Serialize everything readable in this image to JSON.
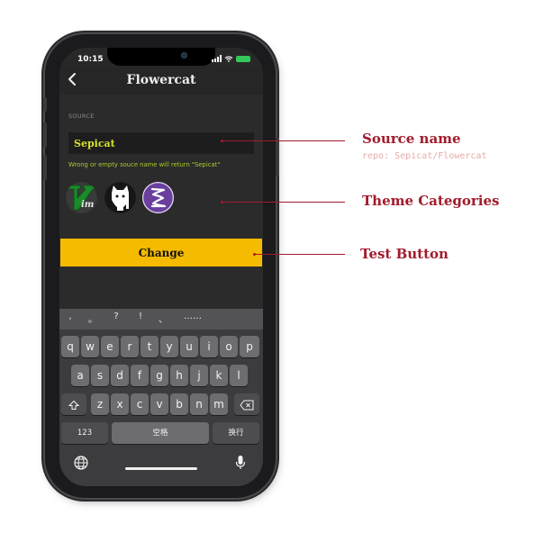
{
  "status_bar": {
    "time": "10:15",
    "battery": ""
  },
  "nav": {
    "title": "Flowercat"
  },
  "form": {
    "source_label": "SOURCE",
    "source_value": "Sepicat",
    "hint": "Wrong or empty souce name will return \"Sepicat\""
  },
  "themes": [
    {
      "name": "vim",
      "icon": "vim-icon"
    },
    {
      "name": "cat",
      "icon": "cat-icon"
    },
    {
      "name": "emacs",
      "icon": "emacs-icon"
    }
  ],
  "button": {
    "change_label": "Change"
  },
  "keyboard": {
    "punctuation": [
      ",",
      "。",
      "?",
      "!",
      "、",
      "……"
    ],
    "row1": [
      "q",
      "w",
      "e",
      "r",
      "t",
      "y",
      "u",
      "i",
      "o",
      "p"
    ],
    "row2": [
      "a",
      "s",
      "d",
      "f",
      "g",
      "h",
      "j",
      "k",
      "l"
    ],
    "row3": [
      "z",
      "x",
      "c",
      "v",
      "b",
      "n",
      "m"
    ],
    "numbers_key": "123",
    "space_key": "空格",
    "return_key": "换行"
  },
  "annotations": {
    "source_name": "Source name",
    "source_repo": "repo: Sepicat/Flowercat",
    "theme_categories": "Theme Categories",
    "test_button": "Test Button"
  },
  "colors": {
    "accent_yellow": "#f5bb00",
    "input_text": "#d8e02a",
    "hint_text": "#a8cc2a",
    "annotation": "#a21b2c",
    "screen_bg": "#2b2b2b"
  }
}
